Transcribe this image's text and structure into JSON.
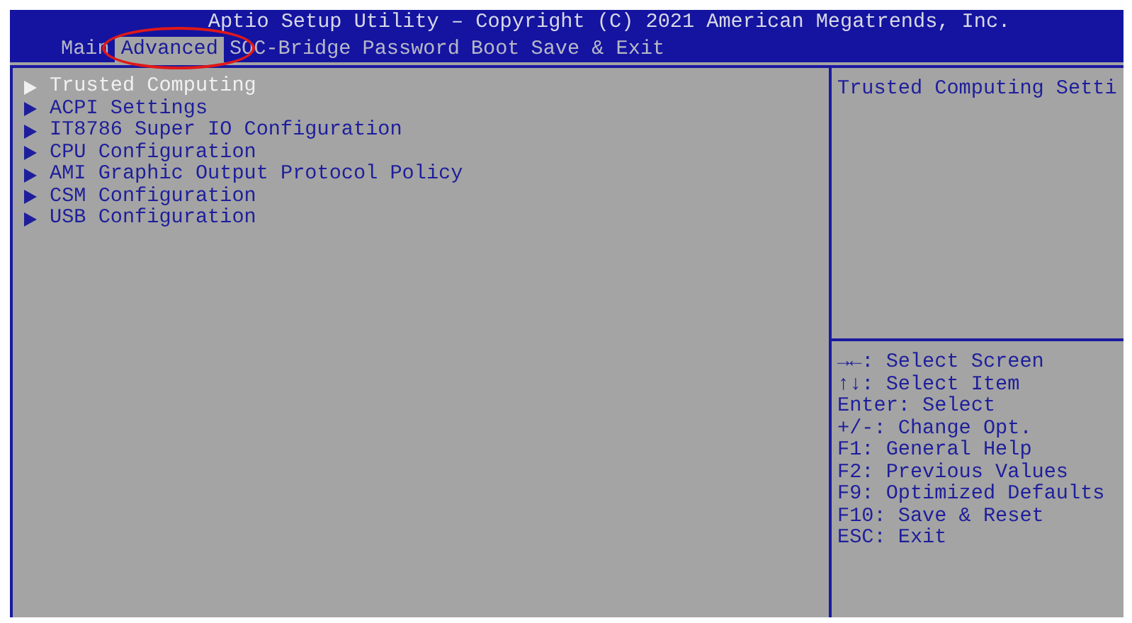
{
  "window": {
    "title": "Aptio Setup Utility – Copyright (C) 2021 American Megatrends, Inc."
  },
  "tabs": [
    {
      "label": "Main",
      "selected": false
    },
    {
      "label": "Advanced",
      "selected": true
    },
    {
      "label": "SOC-Bridge",
      "selected": false
    },
    {
      "label": "Password",
      "selected": false
    },
    {
      "label": "Boot",
      "selected": false
    },
    {
      "label": "Save & Exit",
      "selected": false
    }
  ],
  "menu": {
    "items": [
      {
        "label": "Trusted Computing",
        "selected": true
      },
      {
        "label": "ACPI Settings",
        "selected": false
      },
      {
        "label": "IT8786 Super IO Configuration",
        "selected": false
      },
      {
        "label": "CPU Configuration",
        "selected": false
      },
      {
        "label": "AMI Graphic Output Protocol Policy",
        "selected": false
      },
      {
        "label": "CSM Configuration",
        "selected": false
      },
      {
        "label": "USB Configuration",
        "selected": false
      }
    ]
  },
  "help": {
    "description": "Trusted Computing Setti",
    "keys": [
      "→←: Select Screen",
      "↑↓: Select Item",
      "Enter: Select",
      "+/-: Change Opt.",
      "F1: General Help",
      "F2: Previous Values",
      "F9: Optimized Defaults",
      "F10: Save & Reset",
      "ESC: Exit"
    ]
  }
}
